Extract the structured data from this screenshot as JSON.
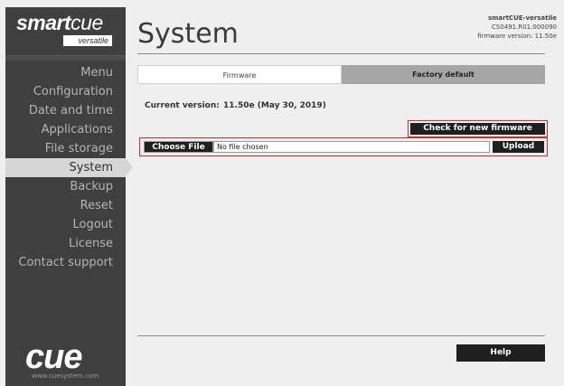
{
  "brand": {
    "logo_bold": "smart",
    "logo_thin": "cue",
    "logo_sub": "versatile",
    "company_logo": "cue",
    "company_url": "www.cuesystem.com"
  },
  "header": {
    "title": "System",
    "device_name": "smartCUE-versatile",
    "device_serial": "CS0491.R01.000090",
    "firmware_info": "firmware version: 11.50e"
  },
  "sidebar": {
    "items": [
      {
        "label": "Menu",
        "active": false
      },
      {
        "label": "Configuration",
        "active": false
      },
      {
        "label": "Date and time",
        "active": false
      },
      {
        "label": "Applications",
        "active": false
      },
      {
        "label": "File storage",
        "active": false
      },
      {
        "label": "System",
        "active": true
      },
      {
        "label": "Backup",
        "active": false
      },
      {
        "label": "Reset",
        "active": false
      },
      {
        "label": "Logout",
        "active": false
      },
      {
        "label": "License",
        "active": false
      },
      {
        "label": "Contact support",
        "active": false
      }
    ]
  },
  "tabs": [
    {
      "label": "Firmware",
      "selected": true
    },
    {
      "label": "Factory default",
      "selected": false
    }
  ],
  "firmware": {
    "current_label": "Current version:",
    "current_value": "11.50e (May 30, 2019)",
    "check_button": "Check for new firmware",
    "choose_file_button": "Choose File",
    "file_status": "No file chosen",
    "upload_button": "Upload"
  },
  "footer": {
    "help_button": "Help"
  },
  "colors": {
    "sidebar_bg": "#3f3f3f",
    "active_item_bg": "#d6d6d6",
    "highlight_border": "#d22a2a",
    "button_bg": "#1f1f1f"
  }
}
